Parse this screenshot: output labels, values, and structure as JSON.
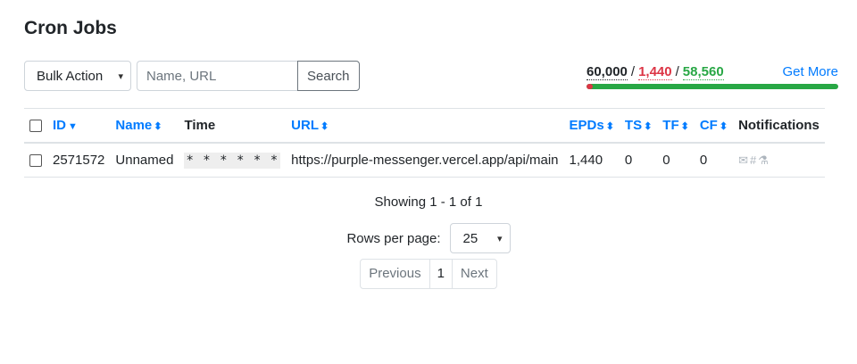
{
  "page": {
    "title": "Cron Jobs"
  },
  "toolbar": {
    "bulk_action_label": "Bulk Action",
    "search_placeholder": "Name, URL",
    "search_value": "",
    "search_button": "Search"
  },
  "quota": {
    "total": "60,000",
    "used": "1,440",
    "available": "58,560",
    "separator": "/",
    "get_more": "Get More",
    "used_fraction": 0.024,
    "colors": {
      "used": "#dc3545",
      "available": "#28a745"
    }
  },
  "table": {
    "headers": {
      "id": "ID",
      "name": "Name",
      "time": "Time",
      "url": "URL",
      "epds": "EPDs",
      "ts": "TS",
      "tf": "TF",
      "cf": "CF",
      "notifications": "Notifications"
    },
    "sort_icon": "⬍",
    "rows": [
      {
        "id": "2571572",
        "name": "Unnamed",
        "time": "* * * * * *",
        "url": "https://purple-messenger.vercel.app/api/main",
        "epds": "1,440",
        "ts": "0",
        "tf": "0",
        "cf": "0",
        "notification_icons": [
          "envelope-icon",
          "slack-icon",
          "webhook-icon"
        ]
      }
    ]
  },
  "pagination": {
    "showing": "Showing 1 - 1 of 1",
    "rows_per_page_label": "Rows per page:",
    "rows_per_page_value": "25",
    "previous": "Previous",
    "current_page": "1",
    "next": "Next"
  },
  "colors": {
    "link": "#007bff",
    "border": "#dee2e6"
  }
}
